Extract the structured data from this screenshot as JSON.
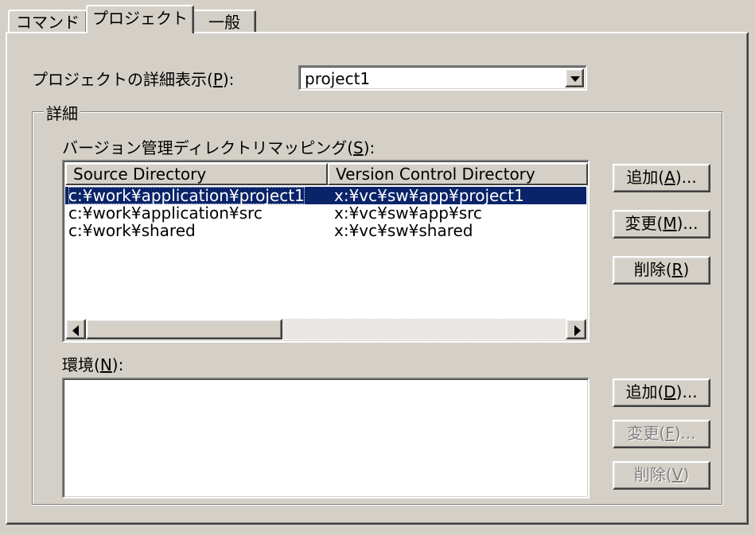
{
  "tabs": [
    {
      "label": "コマンド",
      "active": false
    },
    {
      "label": "プロジェクト",
      "active": true
    },
    {
      "label": "一般",
      "active": false
    }
  ],
  "project_detail": {
    "label_prefix": "プロジェクトの詳細表示(",
    "label_key": "P",
    "label_suffix": "):",
    "selected_value": "project1"
  },
  "details_group": {
    "title": "詳細"
  },
  "mapping": {
    "label_prefix": "バージョン管理ディレクトリマッピング(",
    "label_key": "S",
    "label_suffix": "):",
    "columns": [
      "Source Directory",
      "Version Control Directory"
    ],
    "rows": [
      {
        "source": "c:¥work¥application¥project1",
        "vc": "x:¥vc¥sw¥app¥project1",
        "selected": true
      },
      {
        "source": "c:¥work¥application¥src",
        "vc": "x:¥vc¥sw¥app¥src",
        "selected": false
      },
      {
        "source": "c:¥work¥shared",
        "vc": "x:¥vc¥sw¥shared",
        "selected": false
      }
    ],
    "buttons": {
      "add": {
        "prefix": "追加(",
        "key": "A",
        "suffix": ")..."
      },
      "edit": {
        "prefix": "変更(",
        "key": "M",
        "suffix": ")..."
      },
      "delete": {
        "prefix": "削除(",
        "key": "R",
        "suffix": ")"
      }
    }
  },
  "environment": {
    "label_prefix": "環境(",
    "label_key": "N",
    "label_suffix": "):",
    "buttons": {
      "add": {
        "prefix": "追加(",
        "key": "D",
        "suffix": ")..."
      },
      "edit": {
        "prefix": "変更(",
        "key": "F",
        "suffix": ")...",
        "disabled": true
      },
      "delete": {
        "prefix": "削除(",
        "key": "V",
        "suffix": ")",
        "disabled": true
      }
    }
  },
  "colors": {
    "face": "#d4d0c8",
    "selection": "#0a246a",
    "disabled_text": "#808080"
  }
}
